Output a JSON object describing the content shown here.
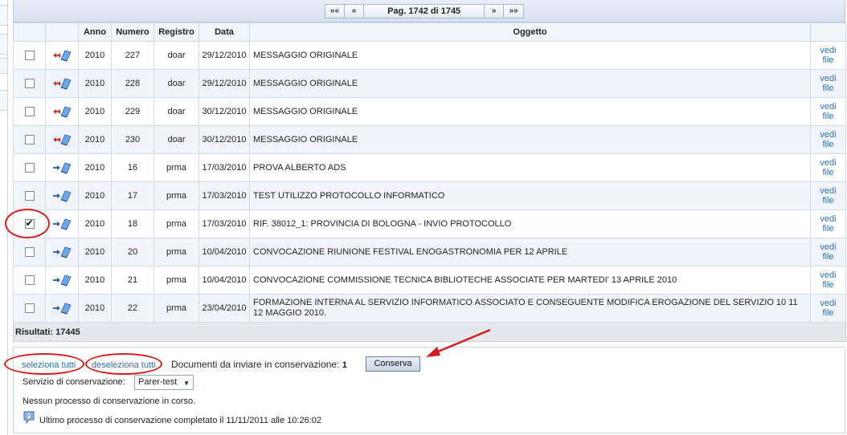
{
  "pager": {
    "first": "««",
    "prev": "«",
    "label": "Pag. 1742 di 1745",
    "next": "»",
    "last": "»»"
  },
  "columns": [
    "",
    "",
    "Anno",
    "Numero",
    "Registro",
    "Data",
    "Oggetto",
    ""
  ],
  "rows": [
    {
      "anno": "2010",
      "numero": "227",
      "registro": "doar",
      "data": "29/12/2010",
      "oggetto": "MESSAGGIO ORIGINALE",
      "link": "vedi file",
      "checked": false,
      "icon": "incoming-arrow-book-icon"
    },
    {
      "anno": "2010",
      "numero": "228",
      "registro": "doar",
      "data": "29/12/2010",
      "oggetto": "MESSAGGIO ORIGINALE",
      "link": "vedi file",
      "checked": false,
      "icon": "incoming-arrow-book-icon"
    },
    {
      "anno": "2010",
      "numero": "229",
      "registro": "doar",
      "data": "30/12/2010",
      "oggetto": "MESSAGGIO ORIGINALE",
      "link": "vedi file",
      "checked": false,
      "icon": "incoming-arrow-book-icon"
    },
    {
      "anno": "2010",
      "numero": "230",
      "registro": "doar",
      "data": "30/12/2010",
      "oggetto": "MESSAGGIO ORIGINALE",
      "link": "vedi file",
      "checked": false,
      "icon": "incoming-arrow-book-icon"
    },
    {
      "anno": "2010",
      "numero": "16",
      "registro": "prma",
      "data": "17/03/2010",
      "oggetto": "PROVA ALBERTO ADS",
      "link": "vedi file",
      "checked": false,
      "icon": "outgoing-arrow-book-icon"
    },
    {
      "anno": "2010",
      "numero": "17",
      "registro": "prma",
      "data": "17/03/2010",
      "oggetto": "TEST UTILIZZO PROTOCOLLO INFORMATICO",
      "link": "vedi file",
      "checked": false,
      "icon": "outgoing-arrow-book-icon"
    },
    {
      "anno": "2010",
      "numero": "18",
      "registro": "prma",
      "data": "17/03/2010",
      "oggetto": "RIF. 38012_1: PROVINCIA DI BOLOGNA - INVIO PROTOCOLLO",
      "link": "vedi file",
      "checked": true,
      "icon": "outgoing-arrow-book-icon"
    },
    {
      "anno": "2010",
      "numero": "20",
      "registro": "prma",
      "data": "10/04/2010",
      "oggetto": "CONVOCAZIONE RIUNIONE FESTIVAL ENOGASTRONOMIA PER 12 APRILE",
      "link": "vedi file",
      "checked": false,
      "icon": "outgoing-arrow-book-icon"
    },
    {
      "anno": "2010",
      "numero": "21",
      "registro": "prma",
      "data": "10/04/2010",
      "oggetto": "CONVOCAZIONE COMMISSIONE TECNICA BIBLIOTECHE ASSOCIATE PER MARTEDI' 13 APRILE 2010",
      "link": "vedi file",
      "checked": false,
      "icon": "outgoing-arrow-book-icon"
    },
    {
      "anno": "2010",
      "numero": "22",
      "registro": "prma",
      "data": "23/04/2010",
      "oggetto": "FORMAZIONE INTERNA AL SERVIZIO INFORMATICO ASSOCIATO E CONSEGUENTE MODIFICA EROGAZIONE DEL SERVIZIO 10 11 12 MAGGIO 2010.",
      "link": "vedi file",
      "checked": false,
      "icon": "outgoing-arrow-book-icon"
    }
  ],
  "results": "Risultati: 17445",
  "bottom": {
    "select_all": "seleziona tutti",
    "deselect_all": "deseleziona tutti",
    "docs_label": "Documenti da inviare in conservazione:",
    "docs_count": "1",
    "conserva_button": "Conserva",
    "service_label": "Servizio di conservazione:",
    "service_value": "Parer-test",
    "no_process": "Nessun processo di conservazione in corso.",
    "last_process": "Ultimo processo di conservazione completato il 11/11/2011 alle 10:26:02"
  },
  "colors": {
    "link": "#2a6fb8",
    "annotation": "#d21e1e",
    "row_alt": "#f1f5fb",
    "incoming_arrow": "#c0392b",
    "outgoing_arrow": "#2a5bb8"
  }
}
